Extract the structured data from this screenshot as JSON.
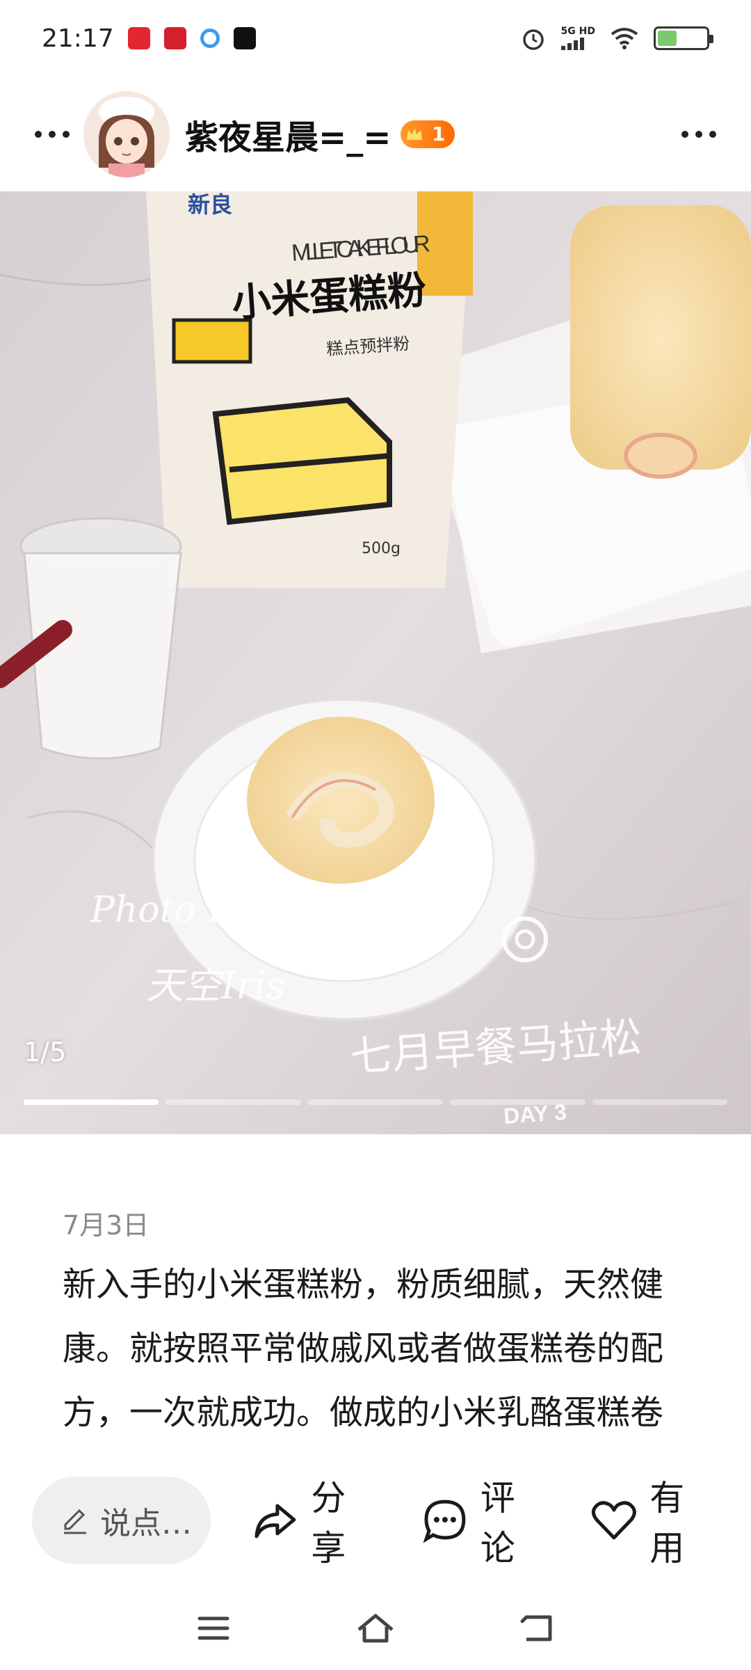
{
  "status_bar": {
    "time": "21:17",
    "notification_icons": [
      "tmall-icon",
      "app-red-icon",
      "browser-icon",
      "tiktok-icon"
    ],
    "network_label": "5G HD",
    "battery_level": "4",
    "battery_fraction": 0.4
  },
  "header": {
    "username": "紫夜星晨=_=",
    "level": "1"
  },
  "photo": {
    "counter": "1/5",
    "total": 5,
    "current": 1,
    "bag_brand": "新良",
    "bag_en_title": "MILLET CAKE FLOUR",
    "bag_cn_title": "小米蛋糕粉",
    "bag_sub": "糕点预拌粉",
    "bag_weight": "500g",
    "watermark_photo_by": "Photo By",
    "watermark_name": "天空Iris",
    "watermark_caption": "七月早餐马拉松",
    "watermark_day": "DAY 3"
  },
  "post": {
    "date": "7月3日",
    "body": "新入手的小米蛋糕粉，粉质细腻，天然健康。就按照平常做戚风或者做蛋糕卷的配方，一次就成功。做成的小米乳酪蛋糕卷很松软，超级好吃，用豆食面回购的！"
  },
  "actions": {
    "comment_placeholder": "说点…",
    "share_label": "分享",
    "comment_label": "评论",
    "useful_label": "有用"
  },
  "colors": {
    "accent_badge": "#ff7a10",
    "progress_active": "#ffffff",
    "input_bg": "#efefef"
  }
}
